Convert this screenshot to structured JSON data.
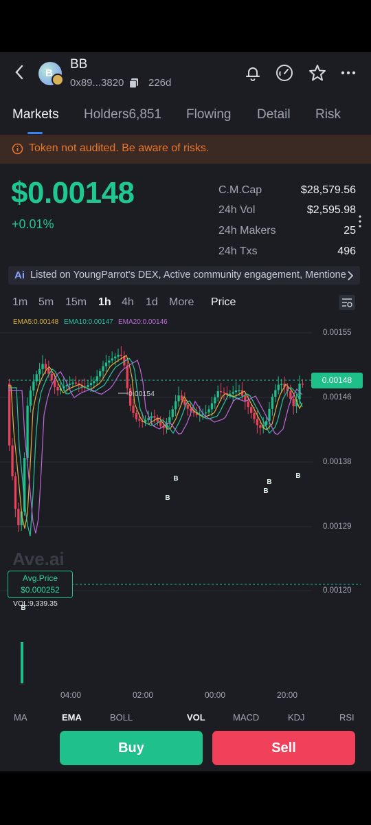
{
  "header": {
    "token_name": "BB",
    "avatar_letter": "B",
    "address": "0x89...3820",
    "age": "226d"
  },
  "tabs": [
    {
      "label": "Markets",
      "active": true
    },
    {
      "label": "Holders6,851",
      "active": false
    },
    {
      "label": "Flowing",
      "active": false
    },
    {
      "label": "Detail",
      "active": false
    },
    {
      "label": "Risk",
      "active": false
    }
  ],
  "warning": "Token not audited. Be aware of risks.",
  "price": {
    "value": "$0.00148",
    "change": "+0.01%"
  },
  "stats": [
    {
      "label": "C.M.Cap",
      "value": "$28,579.56"
    },
    {
      "label": "24h Vol",
      "value": "$2,595.98"
    },
    {
      "label": "24h Makers",
      "value": "25"
    },
    {
      "label": "24h Txs",
      "value": "496"
    }
  ],
  "ai_bar": {
    "logo": "Ai",
    "text": "Listed on YoungParrot's DEX, Active community engagement, Mentione..."
  },
  "timeframes": [
    "1m",
    "5m",
    "15m",
    "1h",
    "4h",
    "1d",
    "More",
    "Price"
  ],
  "active_timeframe": "1h",
  "ema": {
    "ema5": "EMA5:0.00148",
    "ema10": "EMA10:0.00147",
    "ema20": "EMA20:0.00146"
  },
  "chart_data": {
    "type": "candlestick",
    "y_ticks": [
      "0.00155",
      "0.00146",
      "0.00138",
      "0.00129",
      "0.00120"
    ],
    "current_price": "0.00148",
    "high_marker": "0.00154",
    "avg_price_label": "Avg.Price",
    "avg_price_value": "$0.000252",
    "volume_label": "VOL:9,339.35",
    "x_ticks": [
      "04:00",
      "02:00",
      "00:00",
      "20:00"
    ],
    "buy_marker": "B",
    "watermark": "Ave.ai",
    "colors": {
      "up": "#1fbf8a",
      "down": "#e8425a",
      "ema5": "#e0b13c",
      "ema10": "#2cc6a0",
      "ema20": "#c06ad8"
    }
  },
  "indicator_tabs": [
    {
      "label": "MA",
      "active": false
    },
    {
      "label": "EMA",
      "active": true
    },
    {
      "label": "BOLL",
      "active": false
    },
    {
      "label": "VOL",
      "active": true
    },
    {
      "label": "MACD",
      "active": false
    },
    {
      "label": "KDJ",
      "active": false
    },
    {
      "label": "RSI",
      "active": false
    }
  ],
  "actions": {
    "buy": "Buy",
    "sell": "Sell"
  }
}
